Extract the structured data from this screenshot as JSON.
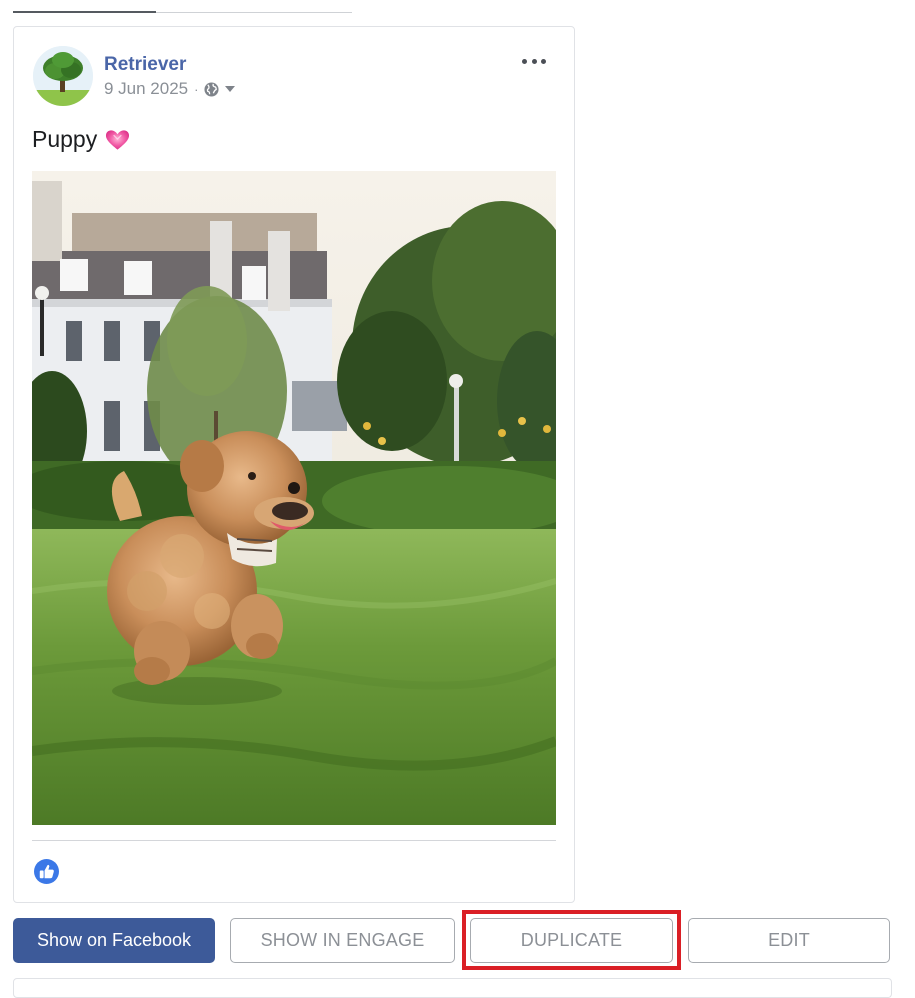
{
  "post": {
    "author": "Retriever",
    "date": "9 Jun 2025",
    "separator": "·",
    "text": "Puppy",
    "privacy_icon": "globe-icon",
    "menu_icon": "more-horizontal-icon",
    "reaction_icon": "like-thumb-icon",
    "emoji_icon": "pink-heart-icon"
  },
  "actions": {
    "show_on_facebook": "Show on Facebook",
    "show_in_engage": "SHOW IN ENGAGE",
    "duplicate": "DUPLICATE",
    "edit": "EDIT"
  },
  "colors": {
    "brand_blue": "#3d5a99",
    "author_link": "#4a66a8",
    "highlight": "#da1f26",
    "like_blue": "#3b78e7"
  }
}
